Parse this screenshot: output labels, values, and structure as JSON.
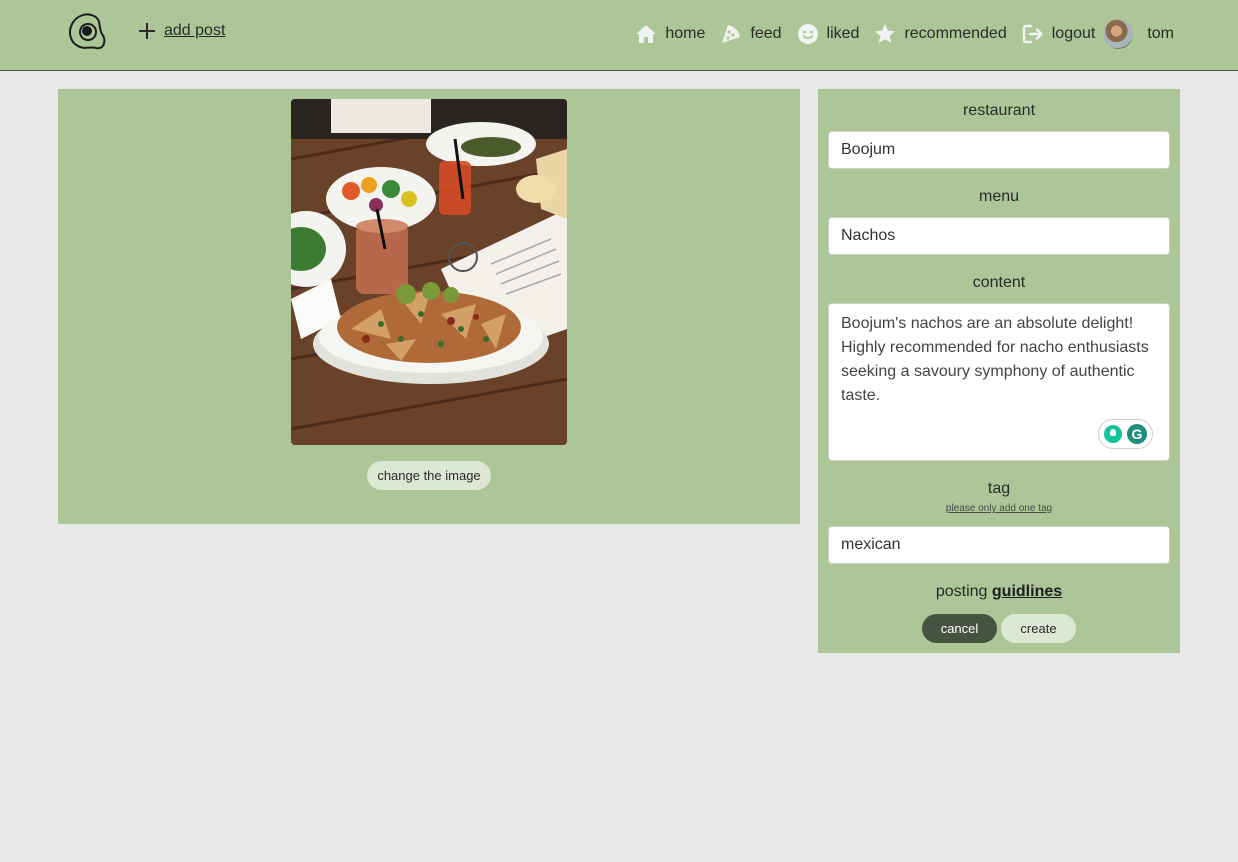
{
  "nav": {
    "logo_icon": "fried-egg-logo-icon",
    "add_post_label": "add post",
    "items": [
      {
        "label": "home",
        "icon": "home-icon"
      },
      {
        "label": "feed",
        "icon": "pizza-slice-icon"
      },
      {
        "label": "liked",
        "icon": "smile-icon"
      },
      {
        "label": "recommended",
        "icon": "star-icon"
      },
      {
        "label": "logout",
        "icon": "logout-icon"
      }
    ],
    "user": "tom"
  },
  "image_panel": {
    "change_image_label": "change the image"
  },
  "form": {
    "restaurant_label": "restaurant",
    "restaurant_value": "Boojum",
    "menu_label": "menu",
    "menu_value": "Nachos",
    "content_label": "content",
    "content_value": "Boojum's nachos are an absolute delight! Highly recommended for nacho enthusiasts seeking a savoury symphony of authentic taste.",
    "tag_label": "tag",
    "tag_hint": "please only add one tag",
    "tag_value": "mexican",
    "guidelines_prefix": "posting",
    "guidelines_link": "guidlines",
    "cancel_label": "cancel",
    "create_label": "create"
  },
  "colors": {
    "panel_green": "#adc698",
    "background": "#e8e8e8",
    "cancel_dark": "#465341",
    "create_light": "#dde8d4"
  }
}
